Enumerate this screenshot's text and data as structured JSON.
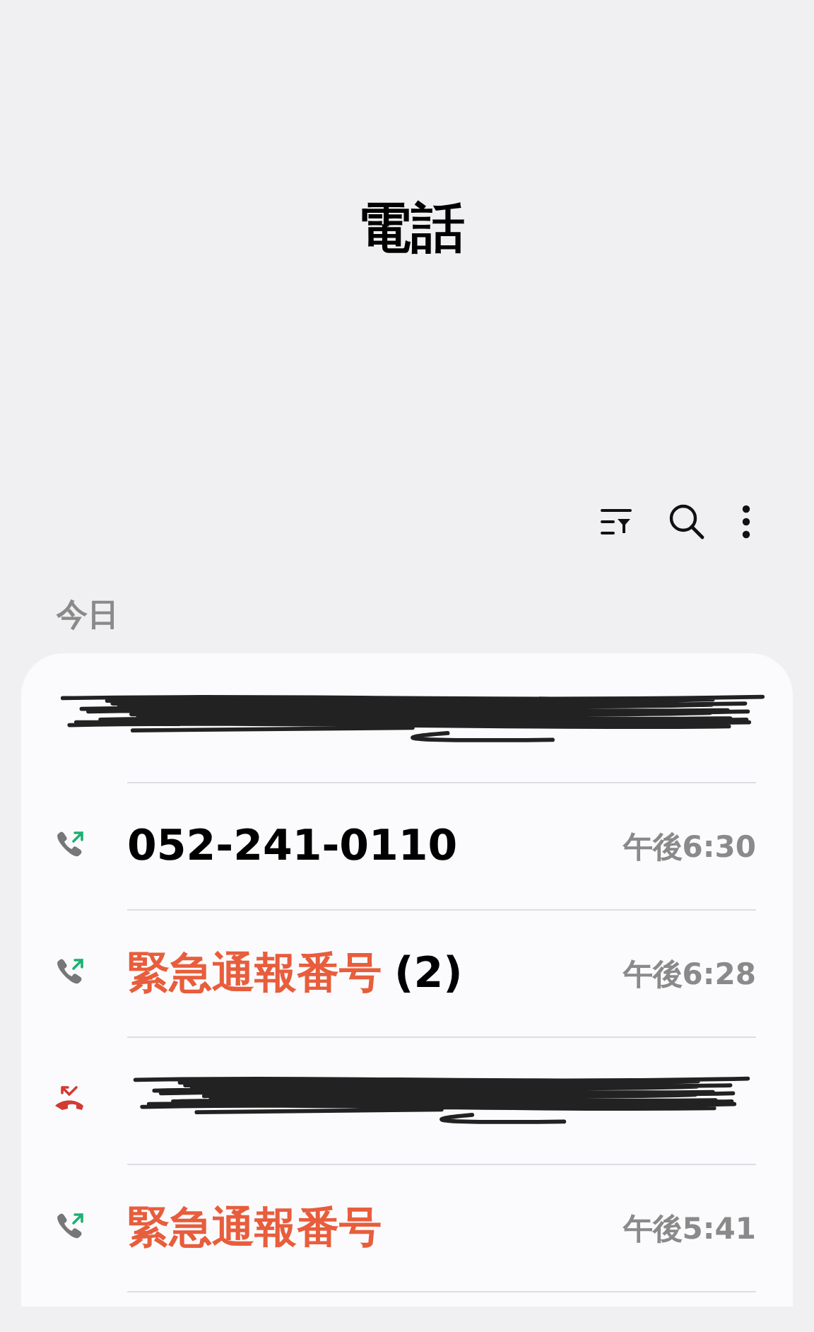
{
  "header": {
    "title": "電話"
  },
  "toolbar": {
    "buttons": [
      {
        "kind": "filter"
      },
      {
        "kind": "search"
      },
      {
        "kind": "more"
      }
    ]
  },
  "section": {
    "label": "今日"
  },
  "calls": [
    {
      "kind": "redacted_wide"
    },
    {
      "kind": "call",
      "missed": false,
      "name": "052-241-0110",
      "emergency": false,
      "time": "午後6:30"
    },
    {
      "kind": "call",
      "missed": false,
      "name": "緊急通報番号",
      "count": "(2)",
      "emergency": true,
      "time": "午後6:28"
    },
    {
      "kind": "redacted",
      "missed": true
    },
    {
      "kind": "call",
      "missed": false,
      "name": "緊急通報番号",
      "emergency": true,
      "time": "午後5:41"
    }
  ]
}
